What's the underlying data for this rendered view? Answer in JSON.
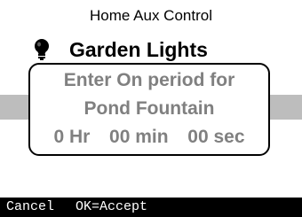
{
  "header": {
    "title": "Home Aux Control"
  },
  "heading": {
    "icon": "light-bulb-icon",
    "label": "Garden Lights"
  },
  "dialog": {
    "line1": "Enter On period for",
    "line2": "Pond Fountain",
    "hours_value": "0",
    "hours_unit": "Hr",
    "minutes_value": "00",
    "minutes_unit": "min",
    "seconds_value": "00",
    "seconds_unit": "sec"
  },
  "softkeys": {
    "left": "Cancel",
    "right": "OK=Accept"
  },
  "colors": {
    "dialog_text": "#808080",
    "highlight_bar": "#bdbdbd",
    "softkey_bar": "#000000",
    "softkey_text": "#ffffff"
  }
}
